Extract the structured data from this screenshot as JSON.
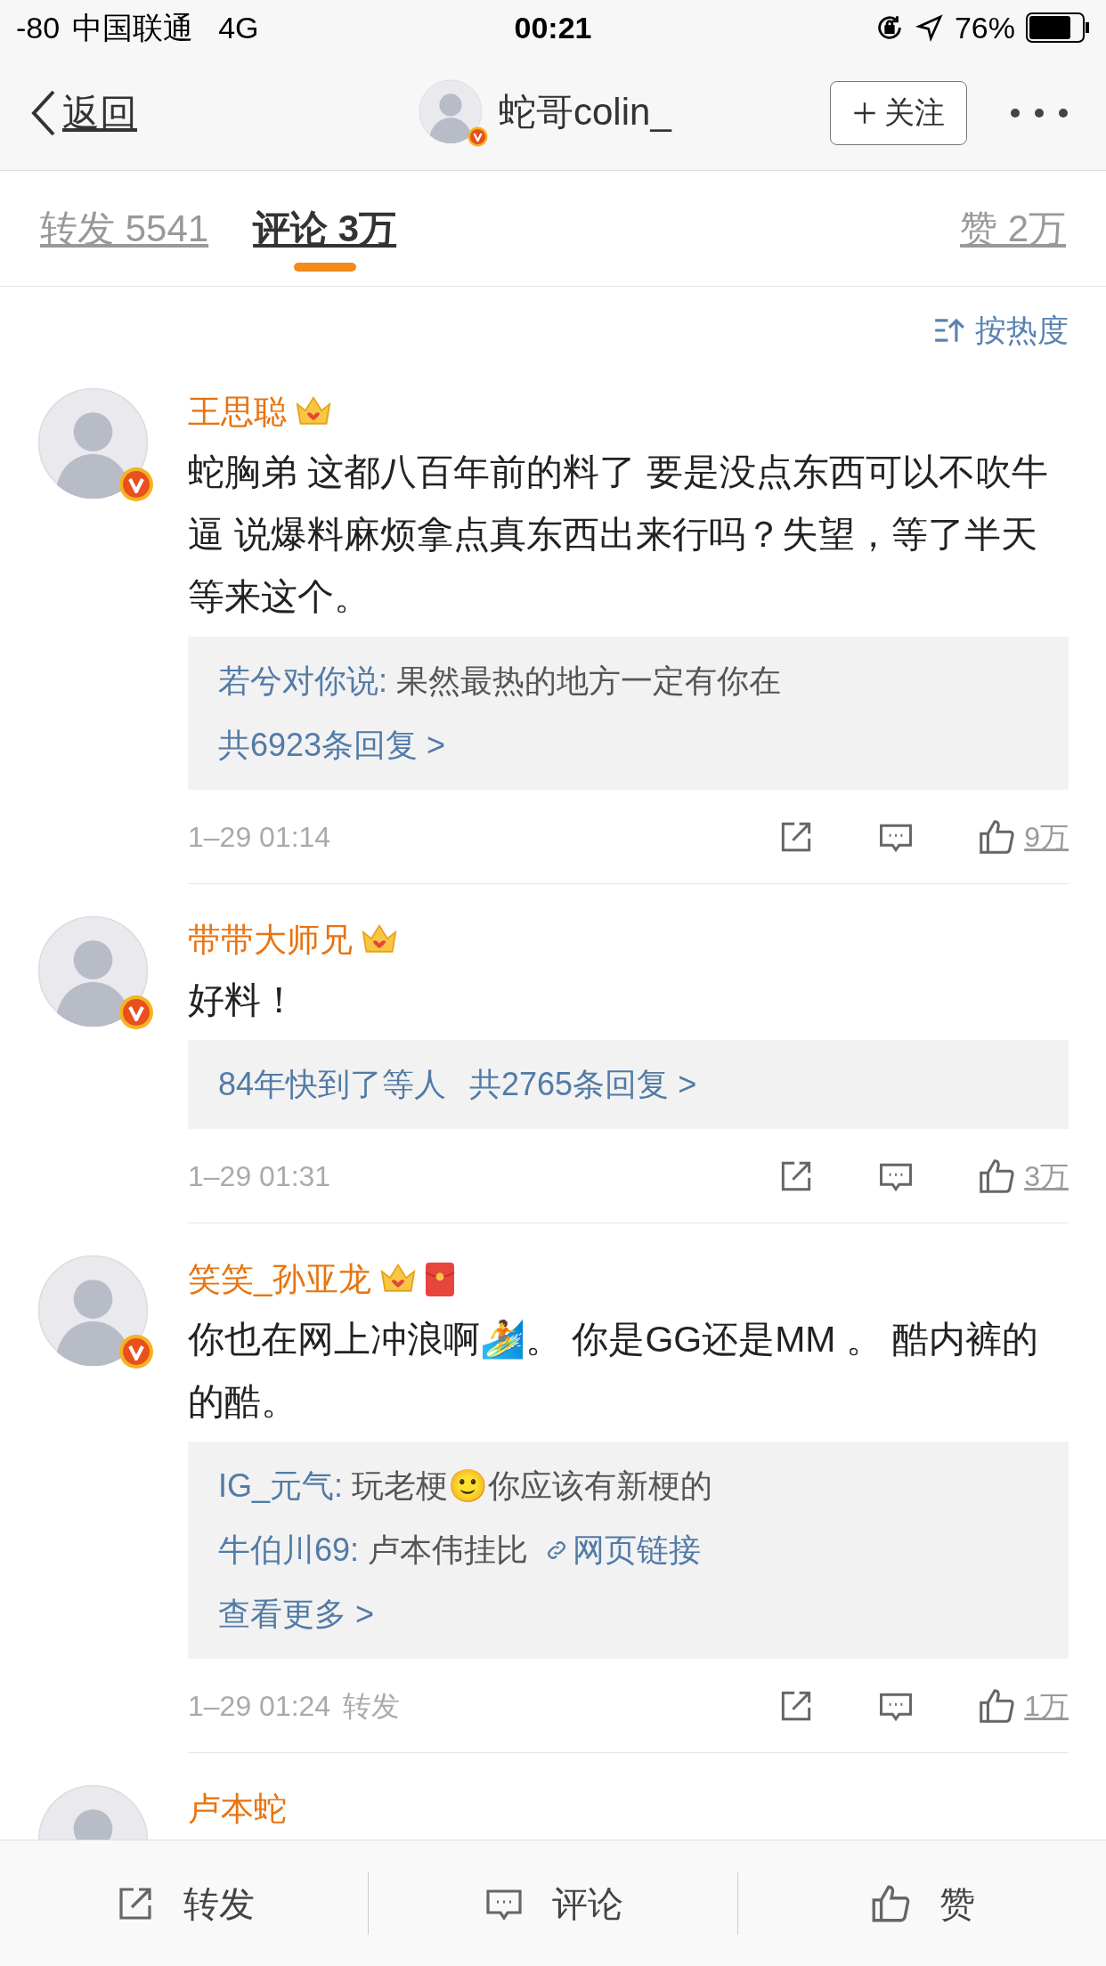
{
  "status_bar": {
    "signal": "-80",
    "carrier": "中国联通",
    "network": "4G",
    "time": "00:21",
    "battery": "76%"
  },
  "nav": {
    "back": "返回",
    "title": "蛇哥colin_",
    "verified": true,
    "follow": "关注"
  },
  "tabs": [
    {
      "label": "转发 5541",
      "selected": false
    },
    {
      "label": "评论 3万",
      "selected": true
    },
    {
      "label": "赞 2万",
      "selected": false
    }
  ],
  "sort": "按热度",
  "comments": [
    {
      "name": "王思聪",
      "vip": true,
      "red_packet": false,
      "verified": true,
      "text": "蛇胸弟 这都八百年前的料了 要是没点东西可以不吹牛逼 说爆料麻烦拿点真东西出来行吗？失望，等了半天等来这个。",
      "replies": [
        {
          "user": "若兮对你说:",
          "text": "果然最热的地方一定有你在"
        }
      ],
      "summary": [
        "共6923条回复 >"
      ],
      "time": "1–29 01:14",
      "likes": "9万"
    },
    {
      "name": "带带大师兄",
      "vip": true,
      "red_packet": false,
      "verified": true,
      "text": "好料！",
      "summary": [
        "84年快到了等人",
        "共2765条回复 >"
      ],
      "time": "1–29 01:31",
      "likes": "3万"
    },
    {
      "name": "笑笑_孙亚龙",
      "vip": true,
      "red_packet": true,
      "verified": true,
      "text": "你也在网上冲浪啊🏄。 你是GG还是MM 。 酷内裤的的酷。",
      "replies": [
        {
          "user": "IG_元气:",
          "text": "玩老梗🙂你应该有新梗的"
        },
        {
          "user": "牛伯川69:",
          "text": "卢本伟挂比",
          "link": "网页链接"
        }
      ],
      "summary": [
        "查看更多 >"
      ],
      "time": "1–29 01:24",
      "source": "转发",
      "likes": "1万"
    },
    {
      "name": "卢本蛇"
    }
  ],
  "bottom_bar": [
    {
      "kind": "share",
      "label": "转发"
    },
    {
      "kind": "comment",
      "label": "评论"
    },
    {
      "kind": "like",
      "label": "赞"
    }
  ]
}
